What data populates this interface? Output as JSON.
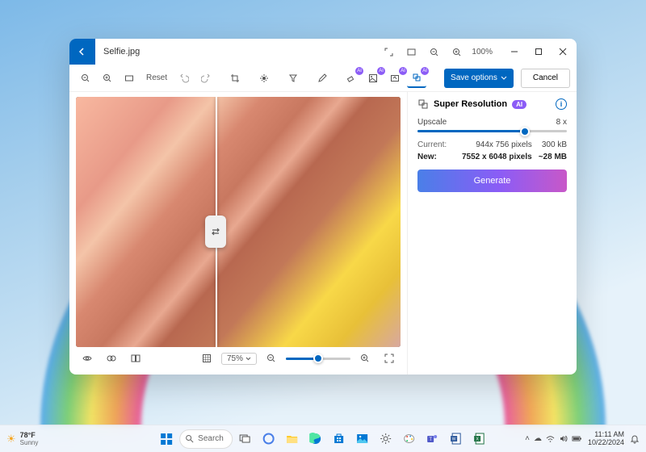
{
  "titlebar": {
    "filename": "Selfie.jpg",
    "zoom": "100%"
  },
  "toolbar": {
    "reset": "Reset",
    "save_options": "Save options",
    "cancel": "Cancel"
  },
  "canvas_footer": {
    "zoom_percent": "75%"
  },
  "panel": {
    "title": "Super Resolution",
    "ai_tag": "AI",
    "upscale_label": "Upscale",
    "upscale_value": "8 x",
    "current_label": "Current:",
    "current_dims": "944x 756 pixels",
    "current_size": "300 kB",
    "new_label": "New:",
    "new_dims": "7552 x 6048 pixels",
    "new_size": "~28 MB",
    "generate": "Generate"
  },
  "taskbar": {
    "temp": "78°F",
    "weather": "Sunny",
    "search": "Search",
    "time": "11:11 AM",
    "date": "10/22/2024"
  }
}
